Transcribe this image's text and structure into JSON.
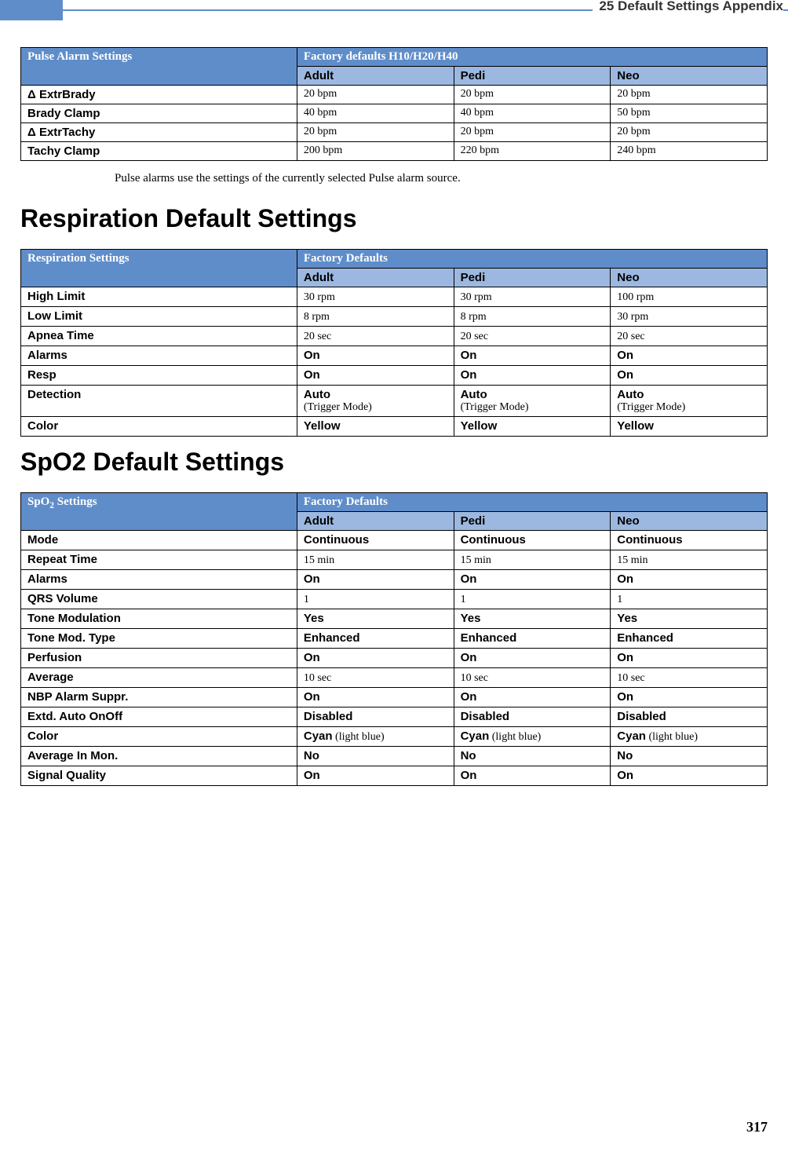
{
  "header": {
    "chapter": "25",
    "title": "Default Settings Appendix",
    "full": "25  Default Settings Appendix"
  },
  "pulse_table": {
    "heading_left": "Pulse Alarm Settings",
    "heading_right": "Factory defaults H10/H20/H40",
    "cols": [
      "Adult",
      "Pedi",
      "Neo"
    ],
    "rows": [
      {
        "label": "Δ ExtrBrady",
        "adult": "20 bpm",
        "pedi": "20 bpm",
        "neo": "20 bpm"
      },
      {
        "label": "Brady Clamp",
        "adult": "40 bpm",
        "pedi": "40 bpm",
        "neo": "50 bpm"
      },
      {
        "label": "Δ ExtrTachy",
        "adult": "20 bpm",
        "pedi": "20 bpm",
        "neo": "20 bpm"
      },
      {
        "label": "Tachy Clamp",
        "adult": "200 bpm",
        "pedi": "220 bpm",
        "neo": "240 bpm"
      }
    ]
  },
  "pulse_note": "Pulse alarms use the settings of the currently selected Pulse alarm source.",
  "resp_heading": "Respiration Default Settings",
  "resp_table": {
    "heading_left": "Respiration Settings",
    "heading_right": "Factory Defaults",
    "cols": [
      "Adult",
      "Pedi",
      "Neo"
    ],
    "rows": [
      {
        "label": "High Limit",
        "adult": "30 rpm",
        "pedi": "30 rpm",
        "neo": "100 rpm",
        "bold": false
      },
      {
        "label": "Low Limit",
        "adult": "8 rpm",
        "pedi": "8 rpm",
        "neo": "30 rpm",
        "bold": false
      },
      {
        "label": "Apnea Time",
        "adult": "20 sec",
        "pedi": "20 sec",
        "neo": "20 sec",
        "bold": false
      },
      {
        "label": "Alarms",
        "adult": "On",
        "pedi": "On",
        "neo": "On",
        "bold": true
      },
      {
        "label": "Resp",
        "adult": "On",
        "pedi": "On",
        "neo": "On",
        "bold": true
      },
      {
        "label": "Detection",
        "adult_main": "Auto",
        "adult_sub": "(Trigger Mode)",
        "pedi_main": "Auto",
        "pedi_sub": "(Trigger Mode)",
        "neo_main": "Auto",
        "neo_sub": "(Trigger Mode)",
        "dual": true
      },
      {
        "label": "Color",
        "adult": "Yellow",
        "pedi": "Yellow",
        "neo": "Yellow",
        "bold": true
      }
    ]
  },
  "spo2_heading": "SpO2 Default Settings",
  "spo2_table": {
    "heading_left_prefix": "SpO",
    "heading_left_sub": "2",
    "heading_left_suffix": " Settings",
    "heading_right": "Factory Defaults",
    "cols": [
      "Adult",
      "Pedi",
      "Neo"
    ],
    "rows": [
      {
        "label": "Mode",
        "adult": "Continuous",
        "pedi": "Continuous",
        "neo": "Continuous",
        "bold": true
      },
      {
        "label": "Repeat Time",
        "adult": "15 min",
        "pedi": "15 min",
        "neo": "15 min",
        "bold": false
      },
      {
        "label": "Alarms",
        "adult": "On",
        "pedi": "On",
        "neo": "On",
        "bold": true
      },
      {
        "label": "QRS Volume",
        "adult": "1",
        "pedi": "1",
        "neo": "1",
        "bold": false
      },
      {
        "label": "Tone Modulation",
        "adult": "Yes",
        "pedi": "Yes",
        "neo": "Yes",
        "bold": true
      },
      {
        "label": "Tone Mod. Type",
        "adult": "Enhanced",
        "pedi": "Enhanced",
        "neo": "Enhanced",
        "bold": true
      },
      {
        "label": "Perfusion",
        "adult": "On",
        "pedi": "On",
        "neo": "On",
        "bold": true
      },
      {
        "label": "Average",
        "adult": "10 sec",
        "pedi": "10 sec",
        "neo": "10 sec",
        "bold": false
      },
      {
        "label": "NBP Alarm Suppr.",
        "adult": "On",
        "pedi": "On",
        "neo": "On",
        "bold": true
      },
      {
        "label": "Extd. Auto OnOff",
        "adult": "Disabled",
        "pedi": "Disabled",
        "neo": "Disabled",
        "bold": true
      },
      {
        "label": "Color",
        "adult_main": "Cyan",
        "adult_sub": " (light blue)",
        "pedi_main": "Cyan",
        "pedi_sub": " (light blue)",
        "neo_main": "Cyan",
        "neo_sub": " (light blue)",
        "mixed": true
      },
      {
        "label": "Average In Mon.",
        "adult": "No",
        "pedi": "No",
        "neo": "No",
        "bold": true
      },
      {
        "label": "Signal Quality",
        "adult": "On",
        "pedi": "On",
        "neo": "On",
        "bold": true
      }
    ]
  },
  "page_number": "317"
}
